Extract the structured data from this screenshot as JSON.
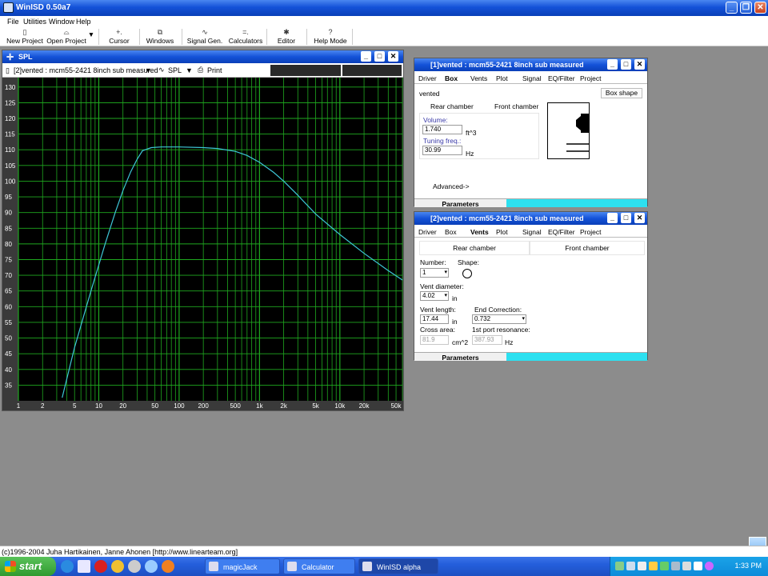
{
  "app": {
    "title": "WinISD 0.50a7"
  },
  "menu": [
    "File",
    "Utilities",
    "Window",
    "Help"
  ],
  "toolbar": {
    "new_project": "New Project",
    "open_project": "Open Project",
    "cursor": "Cursor",
    "windows": "Windows",
    "signal_gen": "Signal Gen.",
    "calculators": "Calculators",
    "editor": "Editor",
    "help_mode": "Help Mode"
  },
  "spl_window": {
    "title": "SPL",
    "project_select": "[2]vented : mcm55-2421 8inch sub measured",
    "graph_select": "SPL",
    "print": "Print"
  },
  "chart_data": {
    "type": "line",
    "xscale": "log",
    "xlim": [
      1,
      60000
    ],
    "ylim": [
      30,
      133
    ],
    "yticks": [
      35,
      40,
      45,
      50,
      55,
      60,
      65,
      70,
      75,
      80,
      85,
      90,
      95,
      100,
      105,
      110,
      115,
      120,
      125,
      130
    ],
    "xtick_labels": [
      {
        "v": 1,
        "t": "1"
      },
      {
        "v": 2,
        "t": "2"
      },
      {
        "v": 5,
        "t": "5"
      },
      {
        "v": 10,
        "t": "10"
      },
      {
        "v": 20,
        "t": "20"
      },
      {
        "v": 50,
        "t": "50"
      },
      {
        "v": 100,
        "t": "100"
      },
      {
        "v": 200,
        "t": "200"
      },
      {
        "v": 500,
        "t": "500"
      },
      {
        "v": 1000,
        "t": "1k"
      },
      {
        "v": 2000,
        "t": "2k"
      },
      {
        "v": 5000,
        "t": "5k"
      },
      {
        "v": 10000,
        "t": "10k"
      },
      {
        "v": 20000,
        "t": "20k"
      },
      {
        "v": 50000,
        "t": "50k"
      }
    ],
    "grid": true,
    "series": [
      {
        "color": "#3ec6d6",
        "x": [
          3.5,
          5,
          8,
          12,
          16,
          20,
          25,
          30,
          35,
          45,
          60,
          80,
          100,
          200,
          300,
          500,
          700,
          1000,
          1500,
          2000,
          3000,
          5000,
          10000,
          20000,
          40000,
          60000
        ],
        "y": [
          31,
          47,
          65,
          80,
          90,
          97,
          103,
          107,
          109.7,
          110.7,
          110.9,
          110.9,
          110.9,
          110.7,
          110.4,
          109.5,
          108.2,
          106,
          102.8,
          100,
          95.5,
          89.5,
          83,
          77,
          71.5,
          68.5
        ]
      }
    ]
  },
  "box_window": {
    "title": "[1]vented :  mcm55-2421 8inch sub measured",
    "tabs": [
      "Driver",
      "Box",
      "Vents",
      "Plot",
      "Signal",
      "EQ/Filter",
      "Project"
    ],
    "type": "vented",
    "box_shape": "Box shape",
    "rear": "Rear chamber",
    "front": "Front chamber",
    "volume_label": "Volume:",
    "volume": "1.740",
    "volume_unit": "ft^3",
    "tuning_label": "Tuning freq.:",
    "tuning": "30.99",
    "tuning_unit": "Hz",
    "advanced": "Advanced->",
    "params": "Parameters"
  },
  "vents_window": {
    "title": "[2]vented :  mcm55-2421 8inch sub measured",
    "tabs": [
      "Driver",
      "Box",
      "Vents",
      "Plot",
      "Signal",
      "EQ/Filter",
      "Project"
    ],
    "rear": "Rear chamber",
    "front": "Front chamber",
    "number_label": "Number:",
    "number": "1",
    "shape_label": "Shape:",
    "diam_label": "Vent diameter:",
    "diam": "4.02",
    "diam_unit": "in",
    "length_label": "Vent length:",
    "length": "17.44",
    "length_unit": "in",
    "endcorr_label": "End Correction:",
    "endcorr": "0.732",
    "cross_label": "Cross area:",
    "cross": "81.9",
    "cross_unit": "cm^2",
    "res_label": "1st port resonance:",
    "res": "387.93",
    "res_unit": "Hz",
    "params": "Parameters"
  },
  "status": "(c)1996-2004 Juha Hartikainen, Janne Ahonen [http://www.linearteam.org]",
  "taskbar": {
    "start": "start",
    "tasks": [
      "magicJack",
      "Calculator",
      "WinISD alpha"
    ],
    "clock": "1:33 PM"
  }
}
